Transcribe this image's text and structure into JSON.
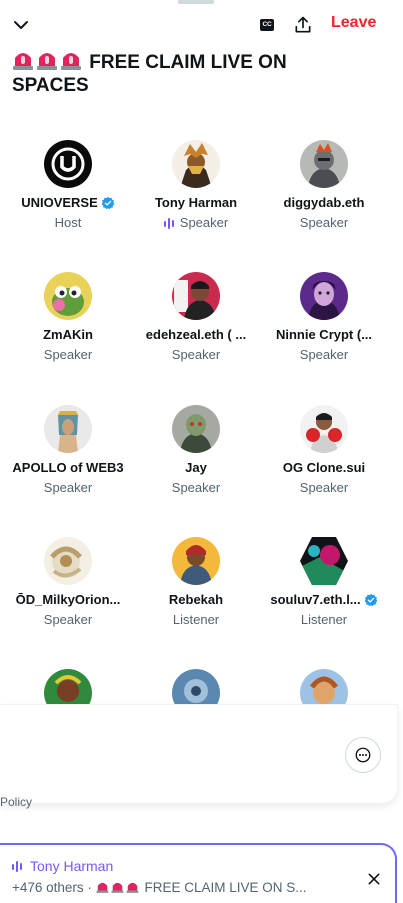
{
  "header": {
    "leave_label": "Leave",
    "cc_label": "CC",
    "title": "FREE CLAIM LIVE ON SPACES",
    "title_emoji": "police-light"
  },
  "participants": [
    {
      "name": "UNIOVERSE",
      "role": "Host",
      "verified": true
    },
    {
      "name": "Tony Harman",
      "role": "Speaker",
      "speaking": true
    },
    {
      "name": "diggydab.eth",
      "role": "Speaker"
    },
    {
      "name": "ZmAKin",
      "role": "Speaker"
    },
    {
      "name": "edehzeal.eth ( ...",
      "role": "Speaker"
    },
    {
      "name": "Ninnie Crypt (...",
      "role": "Speaker"
    },
    {
      "name": "APOLLO of WEB3",
      "role": "Speaker"
    },
    {
      "name": "Jay",
      "role": "Speaker"
    },
    {
      "name": "OG Clone.sui",
      "role": "Speaker"
    },
    {
      "name": "ŌD_MilkyOrion...",
      "role": "Speaker"
    },
    {
      "name": "Rebekah",
      "role": "Listener"
    },
    {
      "name": "souluv7.eth.l...",
      "role": "Listener",
      "verified": true
    }
  ],
  "footer": {
    "policy_text": "Policy"
  },
  "dock": {
    "host_name": "Tony Harman",
    "others": "+476 others ·",
    "space_title": "FREE CLAIM LIVE ON S..."
  },
  "colors": {
    "accent": "#1d9bf0",
    "leave": "#f4212e",
    "dock_border": "#6d6af7",
    "speaking": "#7856ff"
  },
  "icons": [
    "chevron-down-icon",
    "closed-captions-icon",
    "share-icon",
    "verified-badge-icon",
    "speaking-bars-icon",
    "more-icon",
    "close-icon",
    "police-light-icon"
  ]
}
